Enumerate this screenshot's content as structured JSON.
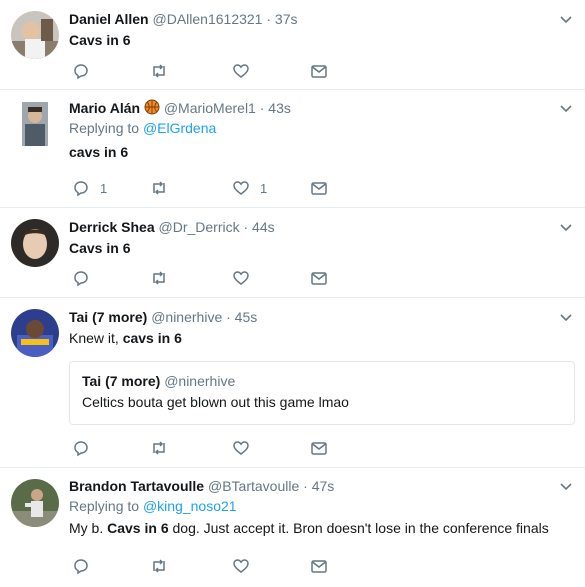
{
  "tweets": [
    {
      "name": "Daniel Allen",
      "handle": "@DAllen1612321",
      "time": "· 37s",
      "text_plain": "",
      "text_bold": "Cavs in 6",
      "text_after": "",
      "replies": "",
      "likes": ""
    },
    {
      "name": "Mario Alán",
      "emoji": "basketball-icon",
      "handle": "@MarioMerel1",
      "time": "· 43s",
      "replying_label": "Replying to",
      "replying_to": "@ElGrdena",
      "text_plain": "",
      "text_bold": "cavs in 6",
      "text_after": "",
      "replies": "1",
      "likes": "1"
    },
    {
      "name": "Derrick Shea",
      "handle": "@Dr_Derrick",
      "time": "· 44s",
      "text_plain": "",
      "text_bold": "Cavs in 6",
      "text_after": "",
      "replies": "",
      "likes": ""
    },
    {
      "name": "Tai (7 more)",
      "handle": "@ninerhive",
      "time": "· 45s",
      "text_plain": "Knew it, ",
      "text_bold": "cavs in 6",
      "text_after": "",
      "quote": {
        "name": "Tai (7 more)",
        "handle": "@ninerhive",
        "text": "Celtics bouta get blown out this game lmao"
      },
      "replies": "",
      "likes": ""
    },
    {
      "name": "Brandon Tartavoulle",
      "handle": "@BTartavoulle",
      "time": "· 47s",
      "replying_label": "Replying to",
      "replying_to": "@king_noso21",
      "text_plain": "My b. ",
      "text_bold": "Cavs in 6",
      "text_after": " dog. Just accept it. Bron doesn't lose in the conference finals",
      "replies": "",
      "likes": ""
    }
  ],
  "colors": {
    "link": "#1da1f2",
    "muted": "#657786",
    "text": "#14171a",
    "divider": "#e6ecf0"
  },
  "icons": {
    "reply": "reply-icon",
    "retweet": "retweet-icon",
    "like": "heart-icon",
    "dm": "envelope-icon",
    "more": "chevron-down-icon"
  }
}
